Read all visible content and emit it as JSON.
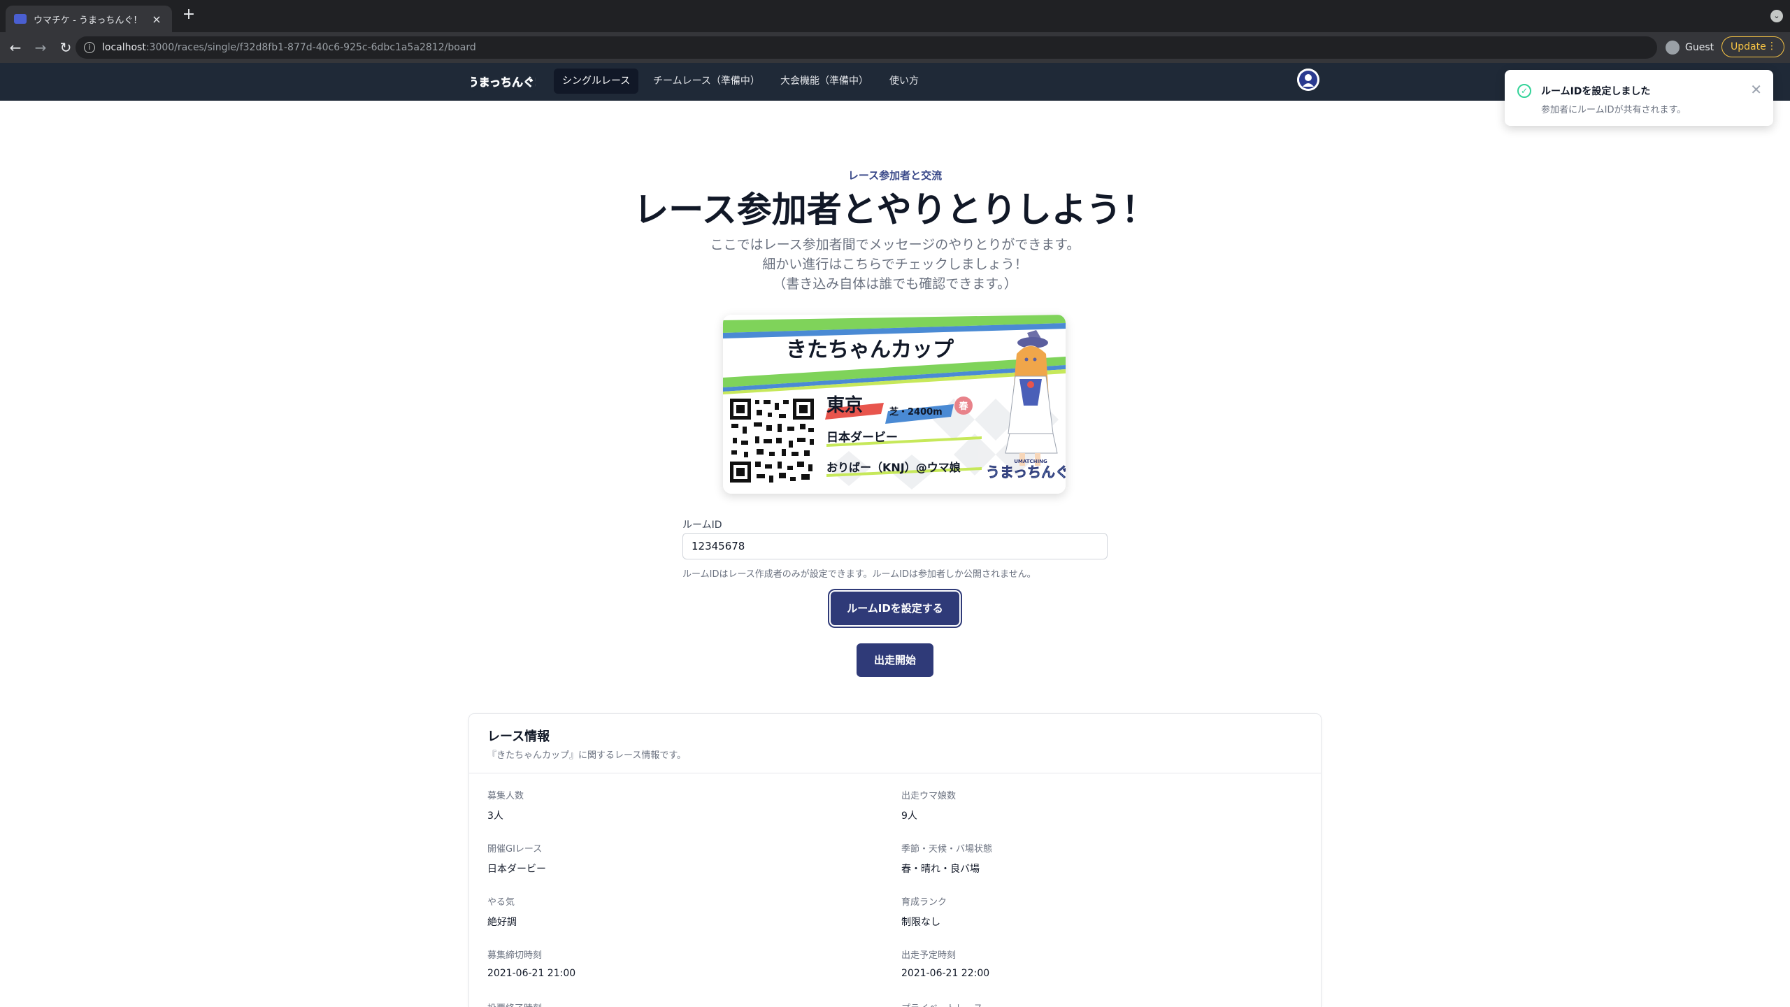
{
  "browser": {
    "tab_title": "ウマチケ - うまっちんぐ！",
    "tab_close": "×",
    "new_tab": "+",
    "url_host": "localhost",
    "url_path": ":3000/races/single/f32d8fb1-877d-40c6-925c-6dbc1a5a2812/board",
    "profile_label": "Guest",
    "update_label": "Update"
  },
  "nav": {
    "items": [
      {
        "label": "シングルレース"
      },
      {
        "label": "チームレース（準備中）"
      },
      {
        "label": "大会機能（準備中）"
      },
      {
        "label": "使い方"
      }
    ]
  },
  "toast": {
    "title": "ルームIDを設定しました",
    "message": "参加者にルームIDが共有されます。"
  },
  "hero": {
    "eyebrow": "レース参加者と交流",
    "title": "レース参加者とやりとりしよう！",
    "lead_1": "ここではレース参加者間でメッセージのやりとりができます。",
    "lead_2": "細かい進行はこちらでチェックしましょう！",
    "lead_3": "（書き込み自体は誰でも確認できます。）"
  },
  "card": {
    "race_name": "きたちゃんカップ",
    "venue": "東京",
    "track": "芝・2400m",
    "season": "春",
    "gi_race": "日本ダービー",
    "organizer": "おりばー（KNJ）@ウマ娘",
    "brand_small": "UMATCHING",
    "brand": "うまっちんぐ!"
  },
  "form": {
    "label": "ルームID",
    "value": "12345678",
    "help": "ルームIDはレース作成者のみが設定できます。ルームIDは参加者しか公開されません。",
    "set_button": "ルームIDを設定する",
    "start_button": "出走開始"
  },
  "info": {
    "title": "レース情報",
    "subtitle": "『きたちゃんカップ』に関するレース情報です。",
    "rows": [
      {
        "label": "募集人数",
        "value": "3人"
      },
      {
        "label": "出走ウマ娘数",
        "value": "9人"
      },
      {
        "label": "開催GIレース",
        "value": "日本ダービー"
      },
      {
        "label": "季節・天候・バ場状態",
        "value": "春・晴れ・良バ場"
      },
      {
        "label": "やる気",
        "value": "絶好調"
      },
      {
        "label": "育成ランク",
        "value": "制限なし"
      },
      {
        "label": "募集締切時刻",
        "value": "2021-06-21 21:00"
      },
      {
        "label": "出走予定時刻",
        "value": "2021-06-21 22:00"
      },
      {
        "label": "投票終了時刻",
        "value": ""
      },
      {
        "label": "プライベートレース",
        "value": ""
      }
    ]
  },
  "colors": {
    "header_bg": "#1f2937",
    "primary": "#2f3a78",
    "success": "#34d399"
  }
}
